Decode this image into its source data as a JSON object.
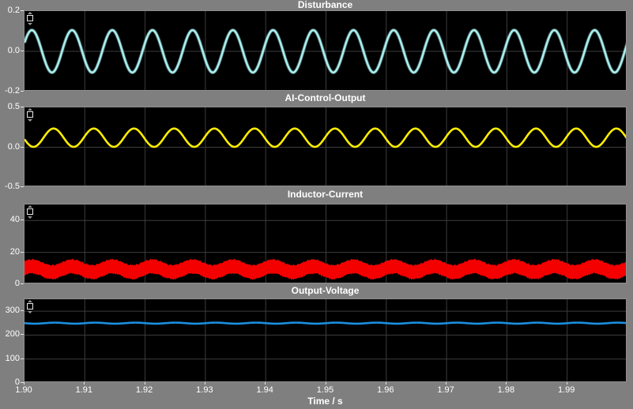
{
  "window": {
    "background": "#7f7f7f",
    "plot_background": "#000000",
    "grid_color": "#3d3d3d",
    "frame_color": "#8f8f8f",
    "tick_color": "#e6e6e6",
    "text_color": "#ffffff"
  },
  "axis": {
    "xlabel": "Time / s",
    "xlim": [
      1.9,
      2.0
    ],
    "xtick_values": [
      1.9,
      1.91,
      1.92,
      1.93,
      1.94,
      1.95,
      1.96,
      1.97,
      1.98,
      1.99
    ],
    "xtick_labels": [
      "1.90",
      "1.91",
      "1.92",
      "1.93",
      "1.94",
      "1.95",
      "1.96",
      "1.97",
      "1.98",
      "1.99"
    ]
  },
  "chart_data": [
    {
      "type": "line",
      "title": "Disturbance",
      "color": "#a9eded",
      "ylim": [
        -0.2,
        0.2
      ],
      "yticks": [
        {
          "v": 0.2,
          "label": "0.2"
        },
        {
          "v": 0.0,
          "label": "0.0"
        },
        {
          "v": -0.2,
          "label": "-0.2"
        }
      ],
      "signal": {
        "kind": "sine",
        "offset": 0.0,
        "amplitude": 0.105,
        "frequency_hz": 150,
        "phase_rad": 0.42
      },
      "glow": true
    },
    {
      "type": "line",
      "title": "AI-Control-Output",
      "color": "#ffee00",
      "ylim": [
        -0.5,
        0.5
      ],
      "yticks": [
        {
          "v": 0.5,
          "label": "0.5"
        },
        {
          "v": 0.0,
          "label": "0.0"
        },
        {
          "v": -0.5,
          "label": "-0.5"
        }
      ],
      "signal": {
        "kind": "sine",
        "offset": 0.12,
        "amplitude": 0.115,
        "frequency_hz": 150,
        "phase_rad": 3.31
      },
      "glow": false
    },
    {
      "type": "band",
      "title": "Inductor-Current",
      "color": "#f40000",
      "ylim": [
        0,
        50
      ],
      "yticks": [
        {
          "v": 40,
          "label": "40"
        },
        {
          "v": 20,
          "label": "20"
        },
        {
          "v": 0,
          "label": "0"
        }
      ],
      "signal": {
        "kind": "modulated-band",
        "center": 9.4,
        "modulation_amplitude": 1.8,
        "frequency_hz": 150,
        "phase_rad": 0.42,
        "half_width": 4.0,
        "ripple": 0.9
      },
      "glow": false
    },
    {
      "type": "line",
      "title": "Output-Voltage",
      "color": "#1a90e0",
      "ylim": [
        0,
        350
      ],
      "yticks": [
        {
          "v": 300,
          "label": "300"
        },
        {
          "v": 200,
          "label": "200"
        },
        {
          "v": 100,
          "label": "100"
        },
        {
          "v": 0,
          "label": "0"
        }
      ],
      "signal": {
        "kind": "sine",
        "offset": 250,
        "amplitude": 2.2,
        "frequency_hz": 150,
        "phase_rad": 3.1
      },
      "glow": false
    }
  ]
}
